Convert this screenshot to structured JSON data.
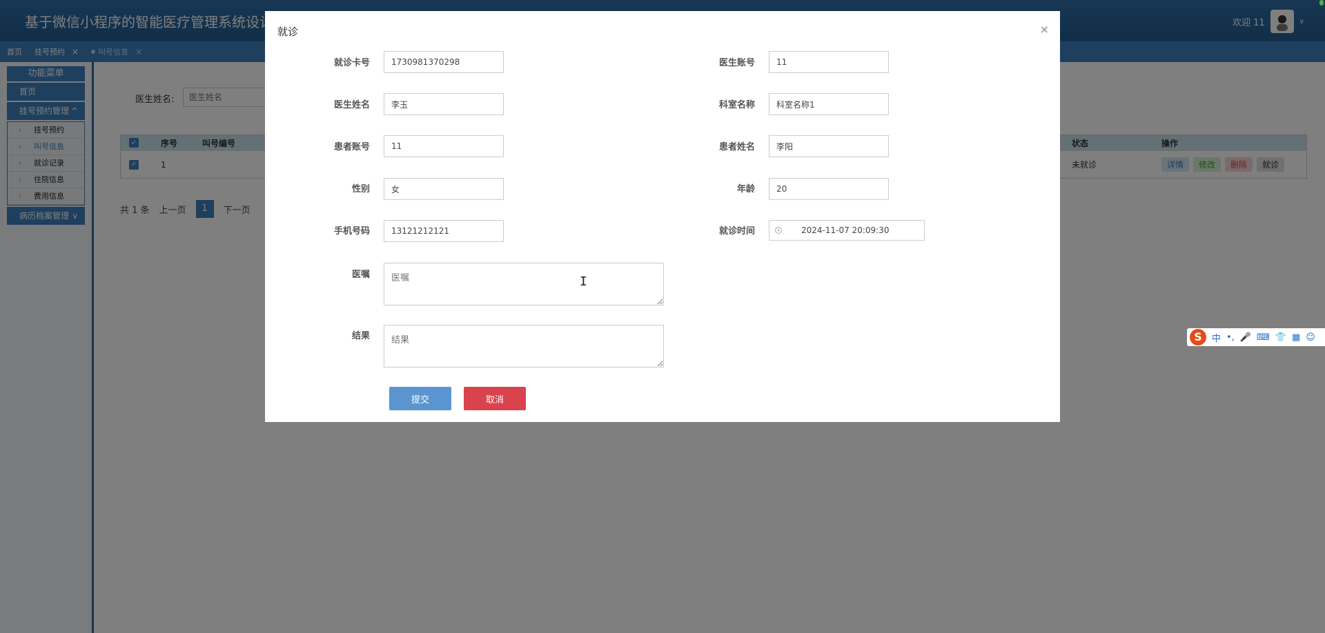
{
  "app": {
    "title": "基于微信小程序的智能医疗管理系统设计与",
    "welcome": "欢迎 11"
  },
  "tabs": [
    {
      "label": "首页"
    },
    {
      "label": "挂号预约"
    },
    {
      "label": "叫号信息"
    }
  ],
  "sidebar": {
    "menu_title": "功能菜单",
    "home": "首页",
    "group1": "挂号预约管理",
    "sub": [
      "挂号预约",
      "叫号信息",
      "就诊记录",
      "住院信息",
      "费用信息"
    ],
    "group2": "病历档案管理"
  },
  "list": {
    "search_label": "医生姓名:",
    "search_placeholder": "医生姓名",
    "cols": {
      "seq": "序号",
      "callno": "叫号编号",
      "status": "状态",
      "ops": "操作"
    },
    "row": {
      "seq": "1",
      "status": "未就诊"
    },
    "row_btns": [
      "详情",
      "修改",
      "删除",
      "就诊"
    ],
    "pager": {
      "total": "共 1 条",
      "prev": "上一页",
      "current": "1",
      "next": "下一页"
    }
  },
  "modal": {
    "title": "就诊",
    "close": "×",
    "labels": {
      "card": "就诊卡号",
      "doc_account": "医生账号",
      "doc_name": "医生姓名",
      "dept": "科室名称",
      "pat_account": "患者账号",
      "pat_name": "患者姓名",
      "gender": "性别",
      "age": "年龄",
      "phone": "手机号码",
      "visit_time": "就诊时间",
      "advice": "医嘱",
      "result": "结果"
    },
    "values": {
      "card": "1730981370298",
      "doc_account": "11",
      "doc_name": "李玉",
      "dept": "科室名称1",
      "pat_account": "11",
      "pat_name": "李阳",
      "gender": "女",
      "age": "20",
      "phone": "13121212121",
      "visit_time": "2024-11-07 20:09:30"
    },
    "placeholders": {
      "advice": "医嘱",
      "result": "结果"
    },
    "submit": "提交",
    "cancel": "取消"
  },
  "ime": {
    "logo": "S",
    "items": [
      "中",
      "•,",
      "🎤",
      "⌨",
      "👕",
      "▦",
      "☺"
    ]
  },
  "icons": {
    "avatar": "avatar-icon",
    "close": "close-icon",
    "clock": "clock-icon",
    "ibeam": "text-cursor-icon"
  }
}
